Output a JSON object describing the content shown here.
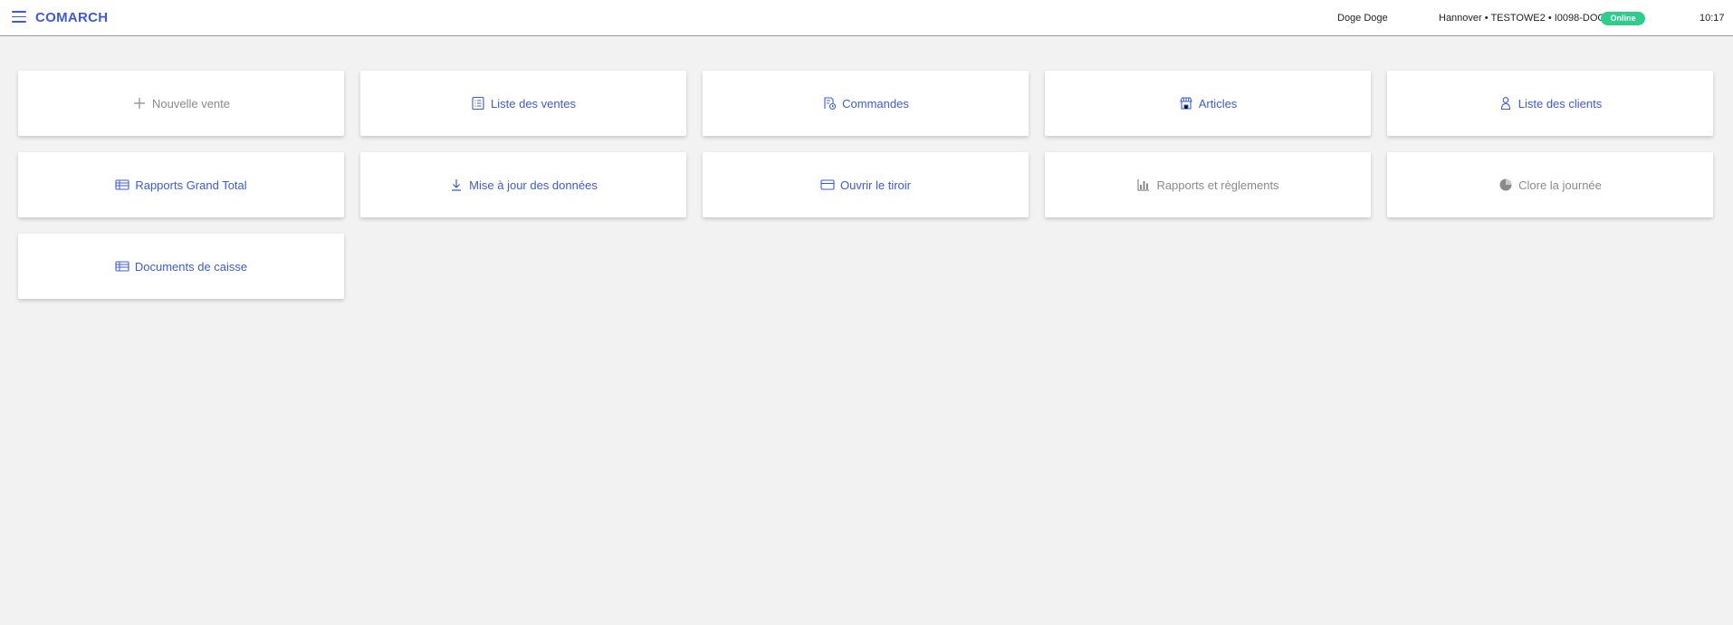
{
  "header": {
    "brand": "COMARCH",
    "user": "Doge Doge",
    "location": "Hannover • TESTOWE2 • I0098-DOGE",
    "status": "Online",
    "time": "10:17"
  },
  "tiles": [
    {
      "label": "Nouvelle vente",
      "icon": "plus-icon",
      "enabled": false
    },
    {
      "label": "Liste des ventes",
      "icon": "list-icon",
      "enabled": true
    },
    {
      "label": "Commandes",
      "icon": "orders-icon",
      "enabled": true
    },
    {
      "label": "Articles",
      "icon": "store-icon",
      "enabled": true
    },
    {
      "label": "Liste des clients",
      "icon": "person-icon",
      "enabled": true
    },
    {
      "label": "Rapports Grand Total",
      "icon": "table-icon",
      "enabled": true
    },
    {
      "label": "Mise à jour des données",
      "icon": "download-icon",
      "enabled": true
    },
    {
      "label": "Ouvrir le tiroir",
      "icon": "card-icon",
      "enabled": true
    },
    {
      "label": "Rapports et règlements",
      "icon": "bar-chart-icon",
      "enabled": false
    },
    {
      "label": "Clore la journée",
      "icon": "pie-icon",
      "enabled": false
    },
    {
      "label": "Documents de caisse",
      "icon": "table-icon",
      "enabled": true
    }
  ],
  "colors": {
    "accent": "#3b5bdb",
    "disabled": "#8a8a8a",
    "status_online": "#2fcc8b",
    "background": "#f2f2f2"
  }
}
